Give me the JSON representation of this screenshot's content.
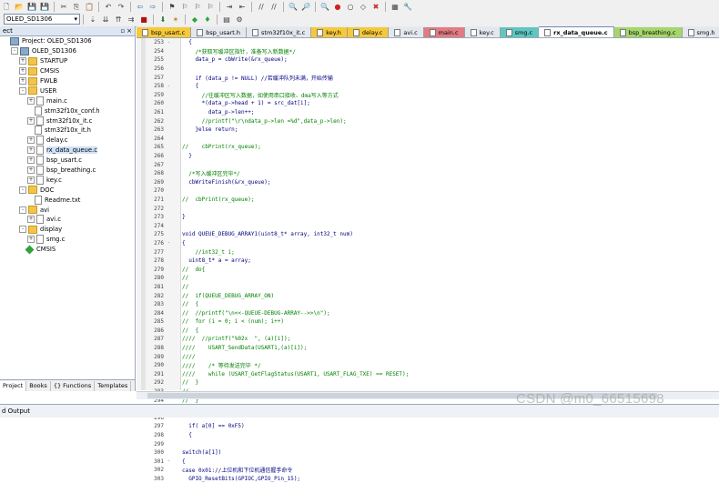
{
  "toolbar": {
    "target_name": "OLED_SD1306",
    "row1_icons": [
      "new-file-icon",
      "open-folder-icon",
      "save-icon",
      "save-all-icon",
      "cut-icon",
      "copy-icon",
      "paste-icon",
      "undo-icon",
      "redo-icon",
      "back-icon",
      "forward-icon",
      "bookmark-icon",
      "bookmark-prev-icon",
      "bookmark-next-icon",
      "bookmark-clear-icon",
      "indent-icon",
      "unindent-icon",
      "comment-icon",
      "uncomment-icon",
      "find-in-files-icon",
      "find-icon",
      "debug-icon",
      "breakpoint-icon",
      "breakpoint-disable-icon",
      "breakpoint-clear-icon",
      "kill-breakpoints-icon",
      "window-layout-icon",
      "config-icon"
    ],
    "row2_icons": [
      "translate-icon",
      "build-icon",
      "rebuild-icon",
      "batch-build-icon",
      "stop-build-icon",
      "download-icon",
      "options-icon",
      "manage-components-icon",
      "pack-installer-icon",
      "copy-layout-icon",
      "run-env-icon"
    ],
    "colors": {
      "bg": "#f0f0f0"
    }
  },
  "sidebar": {
    "title": "ect",
    "tree": [
      {
        "level": 0,
        "exp": "",
        "icon": "proj",
        "label": "Project: OLED_SD1306"
      },
      {
        "level": 1,
        "exp": "-",
        "icon": "proj",
        "label": "OLED_SD1306"
      },
      {
        "level": 2,
        "exp": "+",
        "icon": "folder",
        "label": "STARTUP"
      },
      {
        "level": 2,
        "exp": "+",
        "icon": "folder",
        "label": "CMSIS"
      },
      {
        "level": 2,
        "exp": "+",
        "icon": "folder",
        "label": "FWLB"
      },
      {
        "level": 2,
        "exp": "-",
        "icon": "folder",
        "label": "USER"
      },
      {
        "level": 3,
        "exp": "+",
        "icon": "file",
        "label": "main.c"
      },
      {
        "level": 3,
        "exp": "",
        "icon": "file",
        "label": "stm32f10x_conf.h"
      },
      {
        "level": 3,
        "exp": "+",
        "icon": "file",
        "label": "stm32f10x_it.c"
      },
      {
        "level": 3,
        "exp": "",
        "icon": "file",
        "label": "stm32f10x_it.h"
      },
      {
        "level": 3,
        "exp": "+",
        "icon": "file",
        "label": "delay.c"
      },
      {
        "level": 3,
        "exp": "+",
        "icon": "file",
        "label": "rx_data_queue.c",
        "selected": true
      },
      {
        "level": 3,
        "exp": "+",
        "icon": "file",
        "label": "bsp_usart.c"
      },
      {
        "level": 3,
        "exp": "+",
        "icon": "file",
        "label": "bsp_breathing.c"
      },
      {
        "level": 3,
        "exp": "+",
        "icon": "file",
        "label": "key.c"
      },
      {
        "level": 2,
        "exp": "-",
        "icon": "folder",
        "label": "DOC"
      },
      {
        "level": 3,
        "exp": "",
        "icon": "file",
        "label": "Readme.txt"
      },
      {
        "level": 2,
        "exp": "-",
        "icon": "folder",
        "label": "avi"
      },
      {
        "level": 3,
        "exp": "+",
        "icon": "file",
        "label": "avi.c"
      },
      {
        "level": 2,
        "exp": "-",
        "icon": "folder",
        "label": "display"
      },
      {
        "level": 3,
        "exp": "+",
        "icon": "file",
        "label": "smg.c"
      },
      {
        "level": 2,
        "exp": "",
        "icon": "gem",
        "label": "CMSIS"
      }
    ],
    "bottom_tabs": [
      "Project",
      "Books",
      "{} Functions",
      "Templates"
    ]
  },
  "tabs": [
    {
      "label": "bsp_usart.c",
      "color": "#f6c93a"
    },
    {
      "label": "bsp_usart.h",
      "color": "#e4e8ee"
    },
    {
      "label": "stm32f10x_it.c",
      "color": "#e4e8ee"
    },
    {
      "label": "key.h",
      "color": "#f6c93a"
    },
    {
      "label": "delay.c",
      "color": "#f6c93a"
    },
    {
      "label": "avi.c",
      "color": "#e4e8ee"
    },
    {
      "label": "main.c",
      "color": "#e27b83"
    },
    {
      "label": "key.c",
      "color": "#e4e8ee"
    },
    {
      "label": "smg.c",
      "color": "#5fc7c0"
    },
    {
      "label": "rx_data_queue.c",
      "color": "#ffffff",
      "active": true
    },
    {
      "label": "bsp_breathing.c",
      "color": "#a6d66b"
    },
    {
      "label": "smg.h",
      "color": "#e4e8ee"
    },
    {
      "label": "avi.h",
      "color": "#5fc7c0"
    }
  ],
  "code": [
    {
      "n": "253",
      "f": "-",
      "t": "  {"
    },
    {
      "n": "254",
      "f": "",
      "t": "    /*获取写缓冲区指针，准备写入新数据*/",
      "c": true
    },
    {
      "n": "255",
      "f": "",
      "t": "    data_p = cbWrite(&rx_queue);"
    },
    {
      "n": "256",
      "f": "",
      "t": ""
    },
    {
      "n": "257",
      "f": "",
      "t": "    if (data_p != NULL) //若缓冲队列未满，开始传输"
    },
    {
      "n": "258",
      "f": "-",
      "t": "    {"
    },
    {
      "n": "259",
      "f": "",
      "t": "      //往缓冲区写入数据，如使用串口接收、dma写入等方式",
      "c": true
    },
    {
      "n": "260",
      "f": "",
      "t": "      *(data_p->head + 1) = src_dat[i];"
    },
    {
      "n": "261",
      "f": "",
      "t": "        data_p->len++;"
    },
    {
      "n": "262",
      "f": "",
      "t": "      //printf(\"\\r\\ndata_p->len =%d\",data_p->len);",
      "c": true
    },
    {
      "n": "263",
      "f": "",
      "t": "    }else return;"
    },
    {
      "n": "264",
      "f": "",
      "t": ""
    },
    {
      "n": "265",
      "f": "",
      "t": "//    cbPrint(rx_queue);"
    },
    {
      "n": "266",
      "f": "",
      "t": "  }"
    },
    {
      "n": "267",
      "f": "",
      "t": ""
    },
    {
      "n": "268",
      "f": "",
      "t": "  /*写入缓冲区完毕*/",
      "c": true
    },
    {
      "n": "269",
      "f": "",
      "t": "  cbWriteFinish(&rx_queue);"
    },
    {
      "n": "270",
      "f": "",
      "t": ""
    },
    {
      "n": "271",
      "f": "",
      "t": "//  cbPrint(rx_queue);"
    },
    {
      "n": "272",
      "f": "",
      "t": ""
    },
    {
      "n": "273",
      "f": "",
      "t": "}"
    },
    {
      "n": "274",
      "f": "",
      "t": ""
    },
    {
      "n": "275",
      "f": "",
      "t": "void QUEUE_DEBUG_ARRAY1(uint8_t* array, int32_t num)"
    },
    {
      "n": "276",
      "f": "-",
      "t": "{"
    },
    {
      "n": "277",
      "f": "",
      "t": "    //int32_t i;",
      "c": true
    },
    {
      "n": "278",
      "f": "",
      "t": "  uint8_t* a = array;"
    },
    {
      "n": "279",
      "f": "",
      "t": "//  do{"
    },
    {
      "n": "280",
      "f": "",
      "t": "//"
    },
    {
      "n": "281",
      "f": "",
      "t": "//"
    },
    {
      "n": "282",
      "f": "",
      "t": "//  if(QUEUE_DEBUG_ARRAY_ON)"
    },
    {
      "n": "283",
      "f": "",
      "t": "//  {"
    },
    {
      "n": "284",
      "f": "",
      "t": "//  //printf(\"\\n<<-QUEUE-DEBUG-ARRAY-->>\\n\");"
    },
    {
      "n": "285",
      "f": "",
      "t": "//  for (i = 0; i < (num); i++)"
    },
    {
      "n": "286",
      "f": "",
      "t": "//  {"
    },
    {
      "n": "287",
      "f": "",
      "t": "////  //printf(\"%02x  \", (a)[i]);"
    },
    {
      "n": "288",
      "f": "",
      "t": "////    USART_SendData(USART1,(a)[i]);"
    },
    {
      "n": "289",
      "f": "",
      "t": "////"
    },
    {
      "n": "290",
      "f": "",
      "t": "////    /* 等待发送完毕 */"
    },
    {
      "n": "291",
      "f": "",
      "t": "////    while (USART_GetFlagStatus(USART1, USART_FLAG_TXE) == RESET);"
    },
    {
      "n": "292",
      "f": "",
      "t": "//  }"
    },
    {
      "n": "293",
      "f": "",
      "t": "//"
    },
    {
      "n": "294",
      "f": "",
      "t": "//  }"
    },
    {
      "n": "295",
      "f": "",
      "t": "// }while(0);//调试用"
    },
    {
      "n": "296",
      "f": "",
      "t": ""
    },
    {
      "n": "297",
      "f": "",
      "t": "  if( a[0] == 0xF5)"
    },
    {
      "n": "298",
      "f": "",
      "t": "  {"
    },
    {
      "n": "299",
      "f": "",
      "t": ""
    },
    {
      "n": "300",
      "f": "",
      "t": "switch(a[1])"
    },
    {
      "n": "301",
      "f": "-",
      "t": "{"
    },
    {
      "n": "302",
      "f": "",
      "t": "case 0x01://上位机和下位机通信握手命令"
    },
    {
      "n": "303",
      "f": "",
      "t": "  GPIO_ResetBits(GPIOC,GPIO_Pin_15);"
    }
  ],
  "output": {
    "label": "d Output"
  },
  "watermark": "CSDN @m0_66515698"
}
